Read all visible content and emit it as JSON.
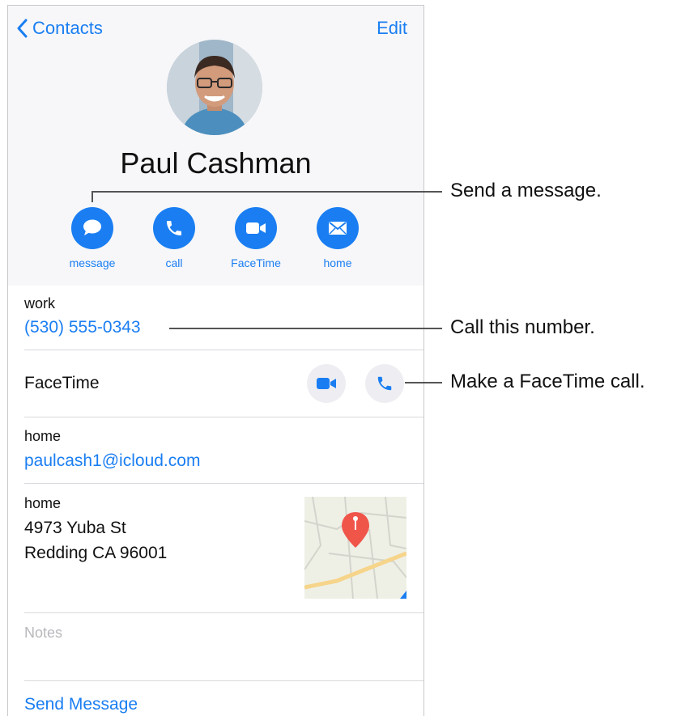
{
  "nav": {
    "back_label": "Contacts",
    "edit_label": "Edit"
  },
  "contact": {
    "name": "Paul Cashman"
  },
  "actions": [
    {
      "label": "message",
      "icon": "message-icon"
    },
    {
      "label": "call",
      "icon": "phone-icon"
    },
    {
      "label": "FaceTime",
      "icon": "video-icon"
    },
    {
      "label": "home",
      "icon": "mail-icon"
    }
  ],
  "phone": {
    "label": "work",
    "value": "(530) 555-0343"
  },
  "facetime": {
    "label": "FaceTime"
  },
  "email": {
    "label": "home",
    "value": "paulcash1@icloud.com"
  },
  "address": {
    "label": "home",
    "line1": "4973 Yuba St",
    "line2": "Redding CA 96001"
  },
  "notes": {
    "label": "Notes"
  },
  "footer": {
    "send_message": "Send Message"
  },
  "callouts": {
    "message": "Send a message.",
    "call_number": "Call this number.",
    "facetime": "Make a FaceTime call."
  },
  "colors": {
    "accent": "#1a7ef2",
    "map_pin": "#f0554a"
  }
}
